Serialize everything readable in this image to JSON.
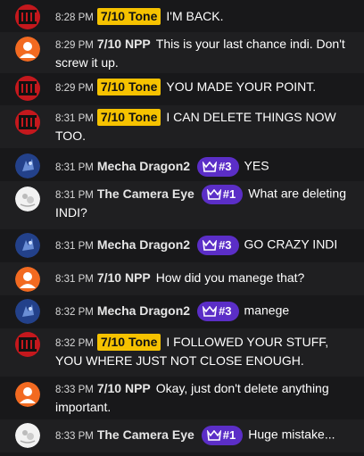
{
  "messages": [
    {
      "avatar": "tone-avatar",
      "time": "8:28 PM",
      "user": "7/10 Tone",
      "badge_type": "tone",
      "text": "I'M BACK."
    },
    {
      "avatar": "npp-avatar",
      "time": "8:29 PM",
      "user": "7/10 NPP",
      "badge_type": "none",
      "text": "This is your last chance indi. Don't screw it up."
    },
    {
      "avatar": "tone-avatar",
      "time": "8:29 PM",
      "user": "7/10 Tone",
      "badge_type": "tone",
      "text": "YOU MADE YOUR POINT."
    },
    {
      "avatar": "tone-avatar",
      "time": "8:31 PM",
      "user": "7/10 Tone",
      "badge_type": "tone",
      "text": "I CAN DELETE THINGS NOW TOO."
    },
    {
      "avatar": "dragon-avatar",
      "time": "8:31 PM",
      "user": "Mecha Dragon2",
      "badge_type": "rank",
      "rank": "#3",
      "text": "YES"
    },
    {
      "avatar": "eye-avatar",
      "time": "8:31 PM",
      "user": "The Camera Eye",
      "badge_type": "rank",
      "rank": "#1",
      "text": "What are deleting INDI?"
    },
    {
      "avatar": "dragon-avatar",
      "time": "8:31 PM",
      "user": "Mecha Dragon2",
      "badge_type": "rank",
      "rank": "#3",
      "text": "GO CRAZY INDI"
    },
    {
      "avatar": "npp-avatar",
      "time": "8:31 PM",
      "user": "7/10 NPP",
      "badge_type": "none",
      "text": "How did you manege that?"
    },
    {
      "avatar": "dragon-avatar",
      "time": "8:32 PM",
      "user": "Mecha Dragon2",
      "badge_type": "rank",
      "rank": "#3",
      "text": "manege"
    },
    {
      "avatar": "tone-avatar",
      "time": "8:32 PM",
      "user": "7/10 Tone",
      "badge_type": "tone",
      "text": "I FOLLOWED YOUR STUFF, YOU WHERE JUST NOT CLOSE ENOUGH."
    },
    {
      "avatar": "npp-avatar",
      "time": "8:33 PM",
      "user": "7/10 NPP",
      "badge_type": "none",
      "text": "Okay, just don't delete anything important."
    },
    {
      "avatar": "eye-avatar",
      "time": "8:33 PM",
      "user": "The Camera Eye",
      "badge_type": "rank",
      "rank": "#1",
      "text": "Huge mistake..."
    }
  ],
  "colors": {
    "background": "#18181a",
    "alt_row": "#1f1f21",
    "tone_badge": "#f6c200",
    "rank_badge": "#5b2ec7",
    "npp_avatar": "#f26a21",
    "tone_avatar": "#c4181d"
  }
}
